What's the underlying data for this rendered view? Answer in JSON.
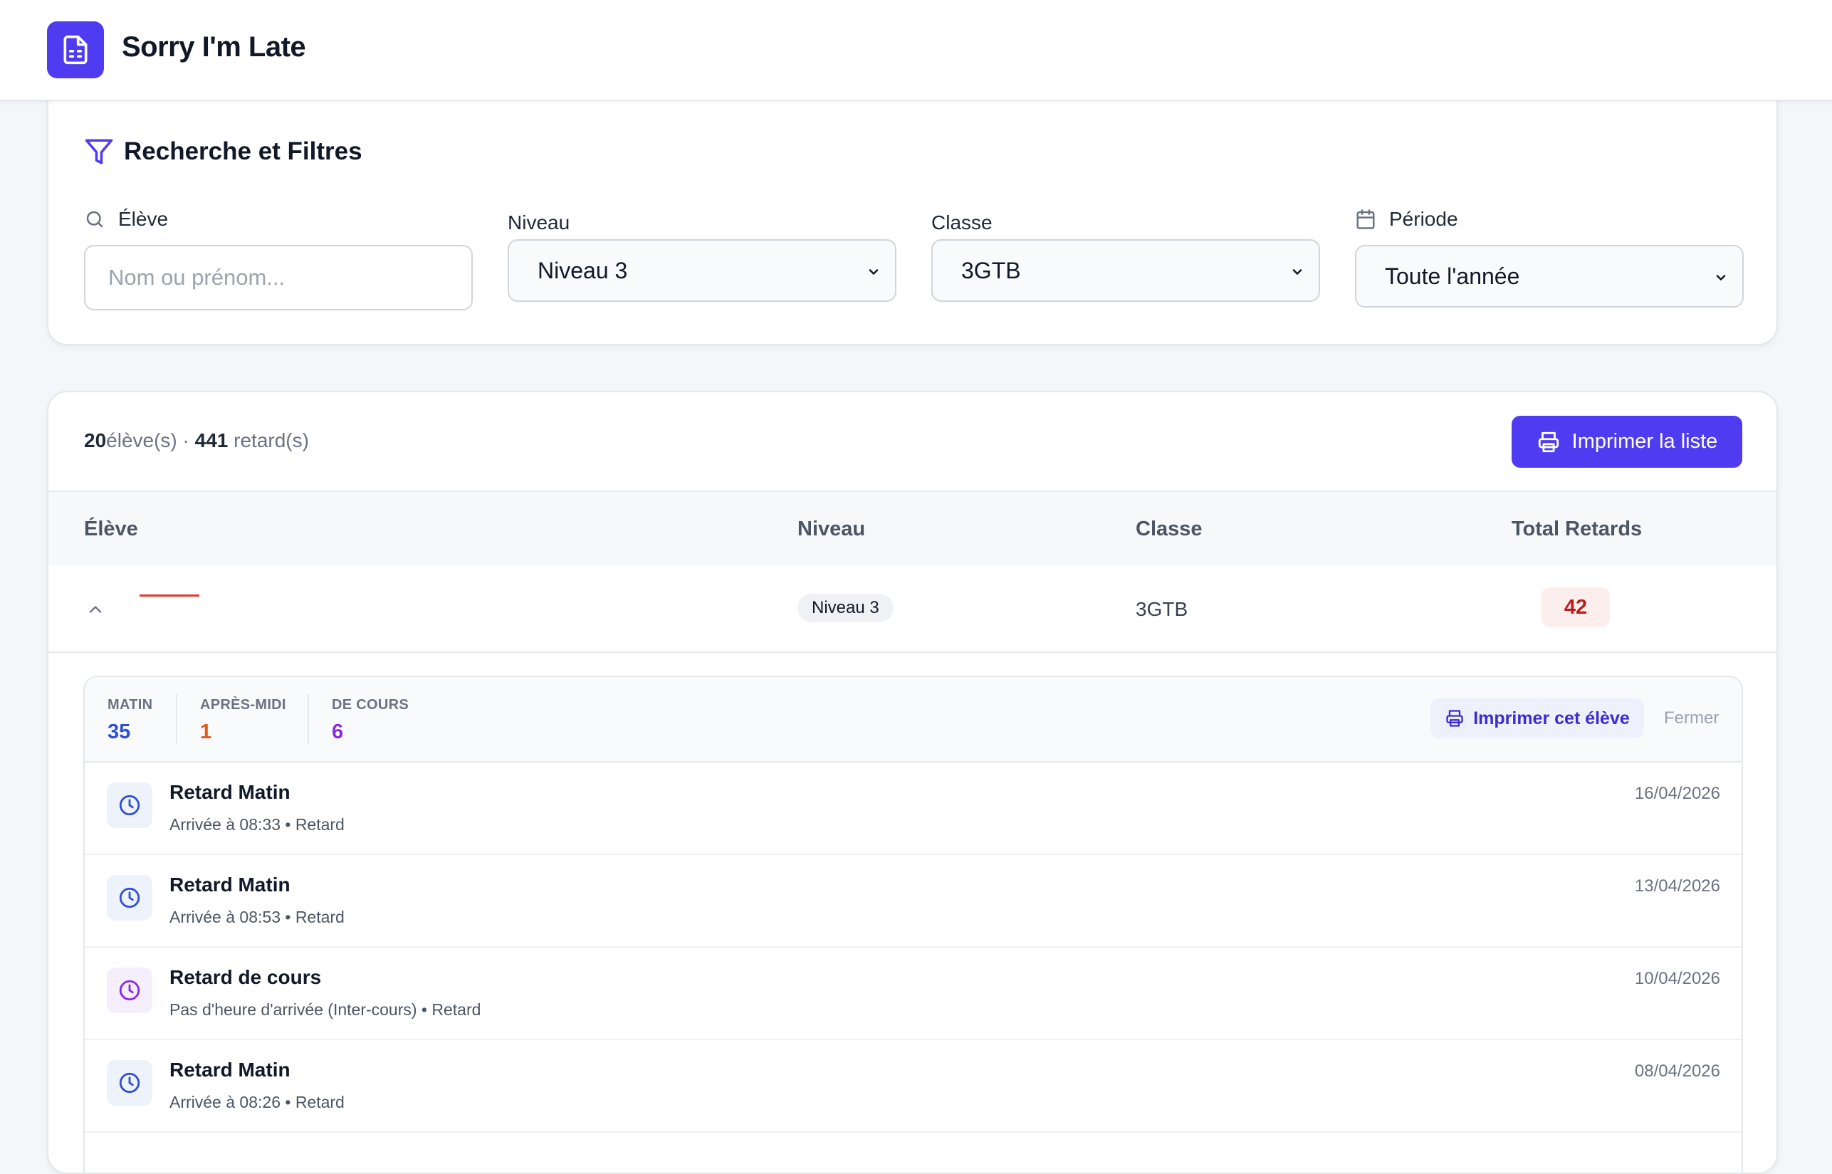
{
  "app": {
    "title": "Sorry I'm Late"
  },
  "colors": {
    "accent": "#4f3cf0",
    "matin": "#2f4fd8",
    "apres_midi": "#e4571b",
    "cours": "#8a2be2",
    "total_badge_text": "#b91c1c"
  },
  "filters": {
    "title": "Recherche et Filtres",
    "eleve": {
      "label": "Élève",
      "placeholder": "Nom ou prénom..."
    },
    "niveau": {
      "label": "Niveau",
      "value": "Niveau 3"
    },
    "classe": {
      "label": "Classe",
      "value": "3GTB"
    },
    "periode": {
      "label": "Période",
      "value": "Toute l'année"
    }
  },
  "list": {
    "summary": {
      "eleves_count": "20",
      "eleves_label": "élève(s)",
      "separator": "·",
      "retards_count": "441",
      "retards_label": "retard(s)"
    },
    "print_button": "Imprimer la liste",
    "columns": {
      "eleve": "Élève",
      "niveau": "Niveau",
      "classe": "Classe",
      "total": "Total Retards"
    },
    "row": {
      "niveau": "Niveau 3",
      "classe": "3GTB",
      "total": "42"
    },
    "detail": {
      "stats": [
        {
          "label": "MATIN",
          "value": "35"
        },
        {
          "label": "APRÈS-MIDI",
          "value": "1"
        },
        {
          "label": "DE COURS",
          "value": "6"
        }
      ],
      "print_button": "Imprimer cet élève",
      "close_label": "Fermer",
      "events": [
        {
          "title": "Retard Matin",
          "subtitle": "Arrivée à 08:33 • Retard",
          "date": "16/04/2026",
          "icon": "clock-icon",
          "kind": "matin"
        },
        {
          "title": "Retard Matin",
          "subtitle": "Arrivée à 08:53 • Retard",
          "date": "13/04/2026",
          "icon": "clock-icon",
          "kind": "matin"
        },
        {
          "title": "Retard de cours",
          "subtitle": "Pas d'heure d'arrivée (Inter-cours) • Retard",
          "date": "10/04/2026",
          "icon": "clock-icon",
          "kind": "cours"
        },
        {
          "title": "Retard Matin",
          "subtitle": "Arrivée à 08:26 • Retard",
          "date": "08/04/2026",
          "icon": "clock-icon",
          "kind": "matin"
        }
      ]
    }
  }
}
